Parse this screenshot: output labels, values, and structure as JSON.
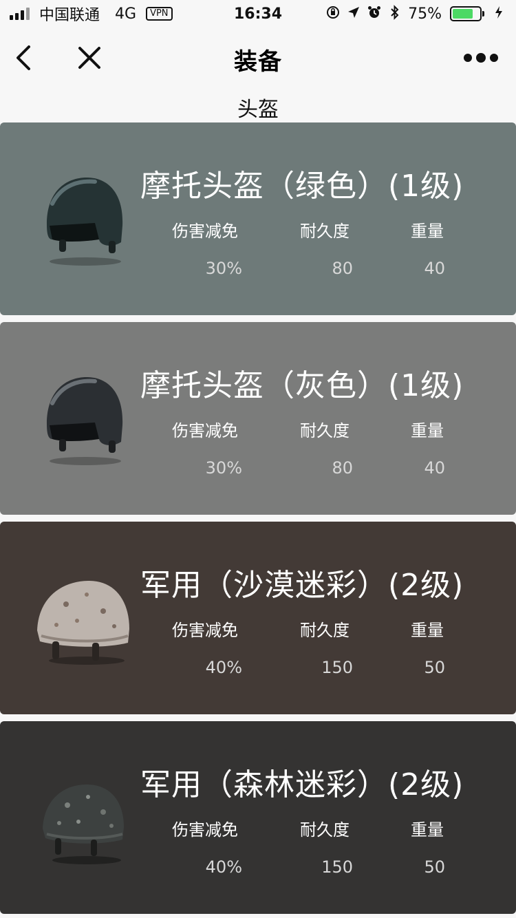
{
  "status_bar": {
    "carrier": "中国联通",
    "network": "4G",
    "vpn": "VPN",
    "time": "16:34",
    "battery_percent": "75%",
    "battery_level": 0.75,
    "icons": [
      "orientation-lock-icon",
      "location-arrow-icon",
      "alarm-icon",
      "bluetooth-icon",
      "charging-bolt-icon"
    ]
  },
  "nav": {
    "title": "装备",
    "back_icon": "chevron-left-icon",
    "close_icon": "close-icon",
    "more_icon": "more-dots-icon"
  },
  "category": "头盔",
  "stat_labels": {
    "damage_reduction": "伤害减免",
    "durability": "耐久度",
    "weight": "重量"
  },
  "items": [
    {
      "name": "摩托头盔（绿色）(1级)",
      "damage_reduction": "30%",
      "durability": "80",
      "weight": "40",
      "bg": "#6e7a79",
      "icon": "motorcycle-helmet-green-icon"
    },
    {
      "name": "摩托头盔（灰色）(1级)",
      "damage_reduction": "30%",
      "durability": "80",
      "weight": "40",
      "bg": "#7b7c7b",
      "icon": "motorcycle-helmet-gray-icon"
    },
    {
      "name": "军用（沙漠迷彩）(2级)",
      "damage_reduction": "40%",
      "durability": "150",
      "weight": "50",
      "bg": "#433a36",
      "icon": "military-helmet-desert-icon"
    },
    {
      "name": "军用（森林迷彩）(2级)",
      "damage_reduction": "40%",
      "durability": "150",
      "weight": "50",
      "bg": "#343332",
      "icon": "military-helmet-forest-icon"
    }
  ]
}
